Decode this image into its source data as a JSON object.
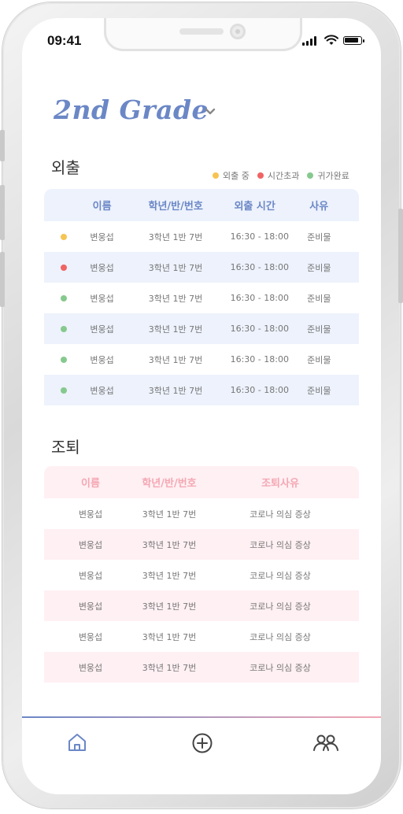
{
  "status": {
    "time": "09:41"
  },
  "header": {
    "title": "2nd Grade"
  },
  "outing": {
    "section_title": "외출",
    "legend": [
      {
        "label": "외출 중",
        "color": "#f6c453"
      },
      {
        "label": "시간초과",
        "color": "#f06464"
      },
      {
        "label": "귀가완료",
        "color": "#86c98e"
      }
    ],
    "columns": [
      "이름",
      "학년/반/번호",
      "외출 시간",
      "사유"
    ],
    "rows": [
      {
        "status_color": "#f6c453",
        "name": "변웅섭",
        "class": "3학년 1반 7번",
        "time": "16:30 - 18:00",
        "reason": "준비물"
      },
      {
        "status_color": "#f06464",
        "name": "변웅섭",
        "class": "3학년 1반 7번",
        "time": "16:30 - 18:00",
        "reason": "준비물"
      },
      {
        "status_color": "#86c98e",
        "name": "변웅섭",
        "class": "3학년 1반 7번",
        "time": "16:30 - 18:00",
        "reason": "준비물"
      },
      {
        "status_color": "#86c98e",
        "name": "변웅섭",
        "class": "3학년 1반 7번",
        "time": "16:30 - 18:00",
        "reason": "준비물"
      },
      {
        "status_color": "#86c98e",
        "name": "변웅섭",
        "class": "3학년 1반 7번",
        "time": "16:30 - 18:00",
        "reason": "준비물"
      },
      {
        "status_color": "#86c98e",
        "name": "변웅섭",
        "class": "3학년 1반 7번",
        "time": "16:30 - 18:00",
        "reason": "준비물"
      }
    ]
  },
  "early_leave": {
    "section_title": "조퇴",
    "columns": [
      "이름",
      "학년/반/번호",
      "조퇴사유"
    ],
    "rows": [
      {
        "name": "변웅섭",
        "class": "3학년 1반 7번",
        "reason": "코로나 의심 증상"
      },
      {
        "name": "변웅섭",
        "class": "3학년 1반 7번",
        "reason": "코로나 의심 증상"
      },
      {
        "name": "변웅섭",
        "class": "3학년 1반 7번",
        "reason": "코로나 의심 증상"
      },
      {
        "name": "변웅섭",
        "class": "3학년 1반 7번",
        "reason": "코로나 의심 증상"
      },
      {
        "name": "변웅섭",
        "class": "3학년 1반 7번",
        "reason": "코로나 의심 증상"
      },
      {
        "name": "변웅섭",
        "class": "3학년 1반 7번",
        "reason": "코로나 의심 증상"
      }
    ]
  },
  "tabbar": {
    "items": [
      {
        "icon": "home-icon"
      },
      {
        "icon": "add-circle-icon"
      },
      {
        "icon": "people-icon"
      }
    ]
  },
  "colors": {
    "accent_blue": "#6b87c6",
    "accent_pink": "#f4a7b3"
  }
}
